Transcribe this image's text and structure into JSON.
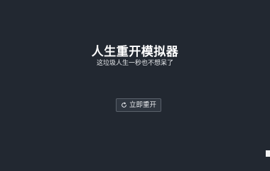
{
  "app": {
    "title": "人生重开模拟器",
    "subtitle": "这垃圾人生一秒也不想呆了"
  },
  "actions": {
    "restart_label": "立即重开",
    "restart_icon": "refresh-icon"
  },
  "colors": {
    "background": "#222831",
    "button_background": "#2f3640",
    "button_border": "#5a616b",
    "text": "#ffffff"
  }
}
